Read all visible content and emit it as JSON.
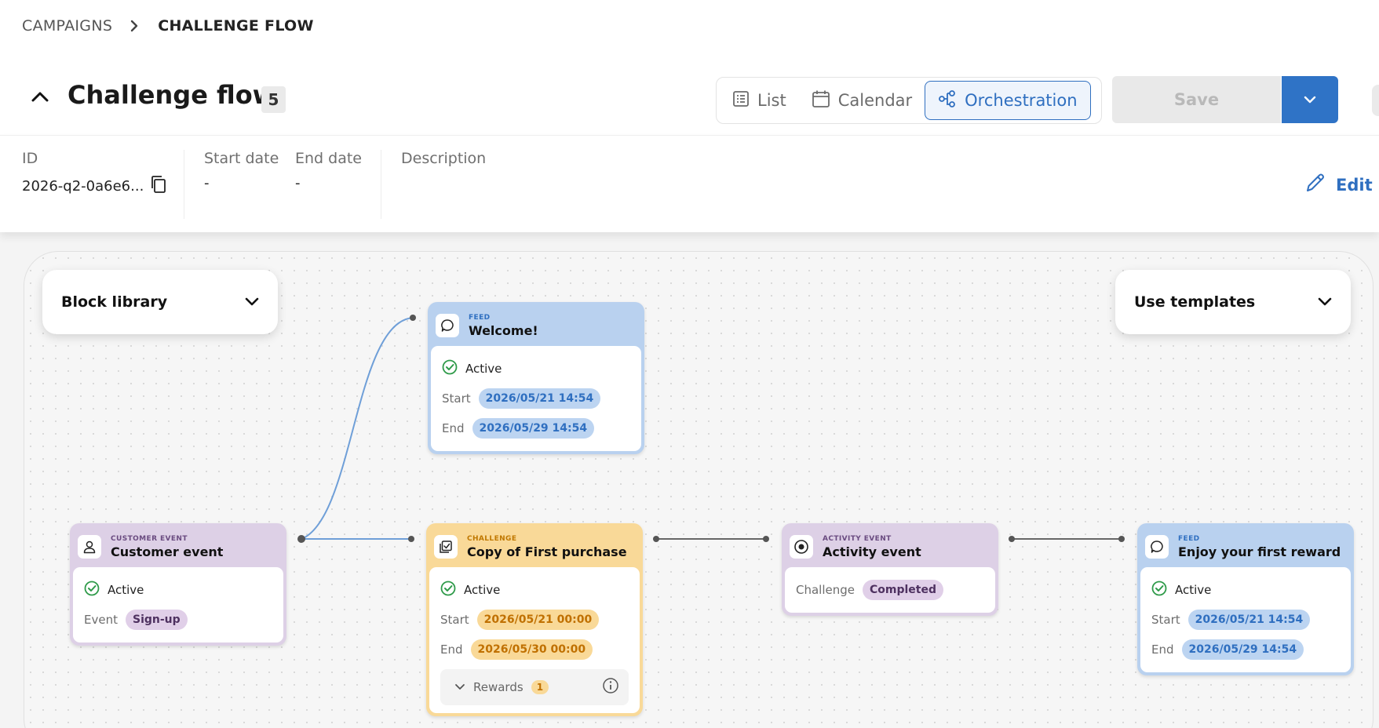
{
  "breadcrumb": {
    "parent": "CAMPAIGNS",
    "current": "CHALLENGE FLOW"
  },
  "header": {
    "title": "Challenge flow",
    "count": "5",
    "views": [
      {
        "label": "List",
        "icon": "list-icon"
      },
      {
        "label": "Calendar",
        "icon": "calendar-icon"
      },
      {
        "label": "Orchestration",
        "icon": "orchestration-icon",
        "active": true
      }
    ],
    "save_label": "Save"
  },
  "info": {
    "id_label": "ID",
    "id_value": "2026-q2-0a6e6...",
    "start_label": "Start date",
    "start_value": "-",
    "end_label": "End date",
    "end_value": "-",
    "description_label": "Description",
    "edit_label": "Edit"
  },
  "canvas": {
    "block_library": "Block library",
    "use_templates": "Use templates",
    "nodes": {
      "welcome": {
        "kind": "FEED",
        "name": "Welcome!",
        "status": "Active",
        "start_label": "Start",
        "start": "2026/05/21 14:54",
        "end_label": "End",
        "end": "2026/05/29 14:54"
      },
      "customer": {
        "kind": "CUSTOMER EVENT",
        "name": "Customer event",
        "status": "Active",
        "event_label": "Event",
        "event": "Sign-up"
      },
      "challenge": {
        "kind": "CHALLENGE",
        "name": "Copy of First purchase",
        "status": "Active",
        "start_label": "Start",
        "start": "2026/05/21 00:00",
        "end_label": "End",
        "end": "2026/05/30 00:00",
        "rewards_label": "Rewards",
        "rewards_count": "1"
      },
      "activity": {
        "kind": "ACTIVITY EVENT",
        "name": "Activity event",
        "challenge_label": "Challenge",
        "challenge_state": "Completed"
      },
      "reward": {
        "kind": "FEED",
        "name": "Enjoy your first reward",
        "status": "Active",
        "start_label": "Start",
        "start": "2026/05/21 14:54",
        "end_label": "End",
        "end": "2026/05/29 14:54"
      }
    }
  },
  "colors": {
    "accent": "#2f73c6",
    "feed": "#b9d1ef",
    "event": "#ddd0e6",
    "challenge": "#f9d998",
    "active_check": "#2e9a49"
  }
}
